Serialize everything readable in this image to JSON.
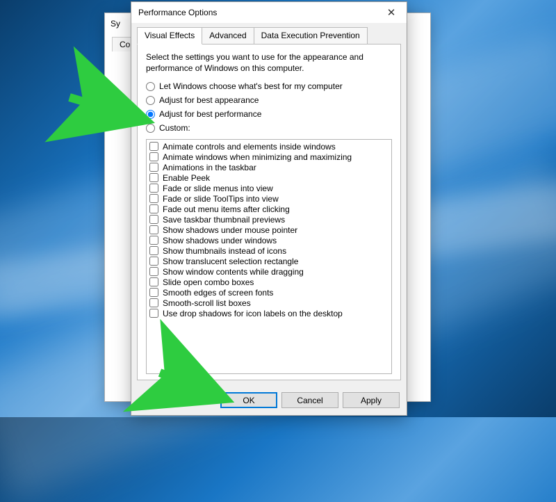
{
  "background_window": {
    "title_partial": "Sy",
    "tab_partial": "Co"
  },
  "dialog": {
    "title": "Performance Options",
    "tabs": [
      {
        "label": "Visual Effects",
        "active": true
      },
      {
        "label": "Advanced",
        "active": false
      },
      {
        "label": "Data Execution Prevention",
        "active": false
      }
    ],
    "description": "Select the settings you want to use for the appearance and performance of Windows on this computer.",
    "radios": [
      {
        "label": "Let Windows choose what's best for my computer",
        "checked": false
      },
      {
        "label": "Adjust for best appearance",
        "checked": false
      },
      {
        "label": "Adjust for best performance",
        "checked": true
      },
      {
        "label": "Custom:",
        "checked": false
      }
    ],
    "checkboxes": [
      "Animate controls and elements inside windows",
      "Animate windows when minimizing and maximizing",
      "Animations in the taskbar",
      "Enable Peek",
      "Fade or slide menus into view",
      "Fade or slide ToolTips into view",
      "Fade out menu items after clicking",
      "Save taskbar thumbnail previews",
      "Show shadows under mouse pointer",
      "Show shadows under windows",
      "Show thumbnails instead of icons",
      "Show translucent selection rectangle",
      "Show window contents while dragging",
      "Slide open combo boxes",
      "Smooth edges of screen fonts",
      "Smooth-scroll list boxes",
      "Use drop shadows for icon labels on the desktop"
    ],
    "buttons": {
      "ok": "OK",
      "cancel": "Cancel",
      "apply": "Apply"
    }
  },
  "annotation": {
    "arrow_color": "#2ecc40"
  }
}
